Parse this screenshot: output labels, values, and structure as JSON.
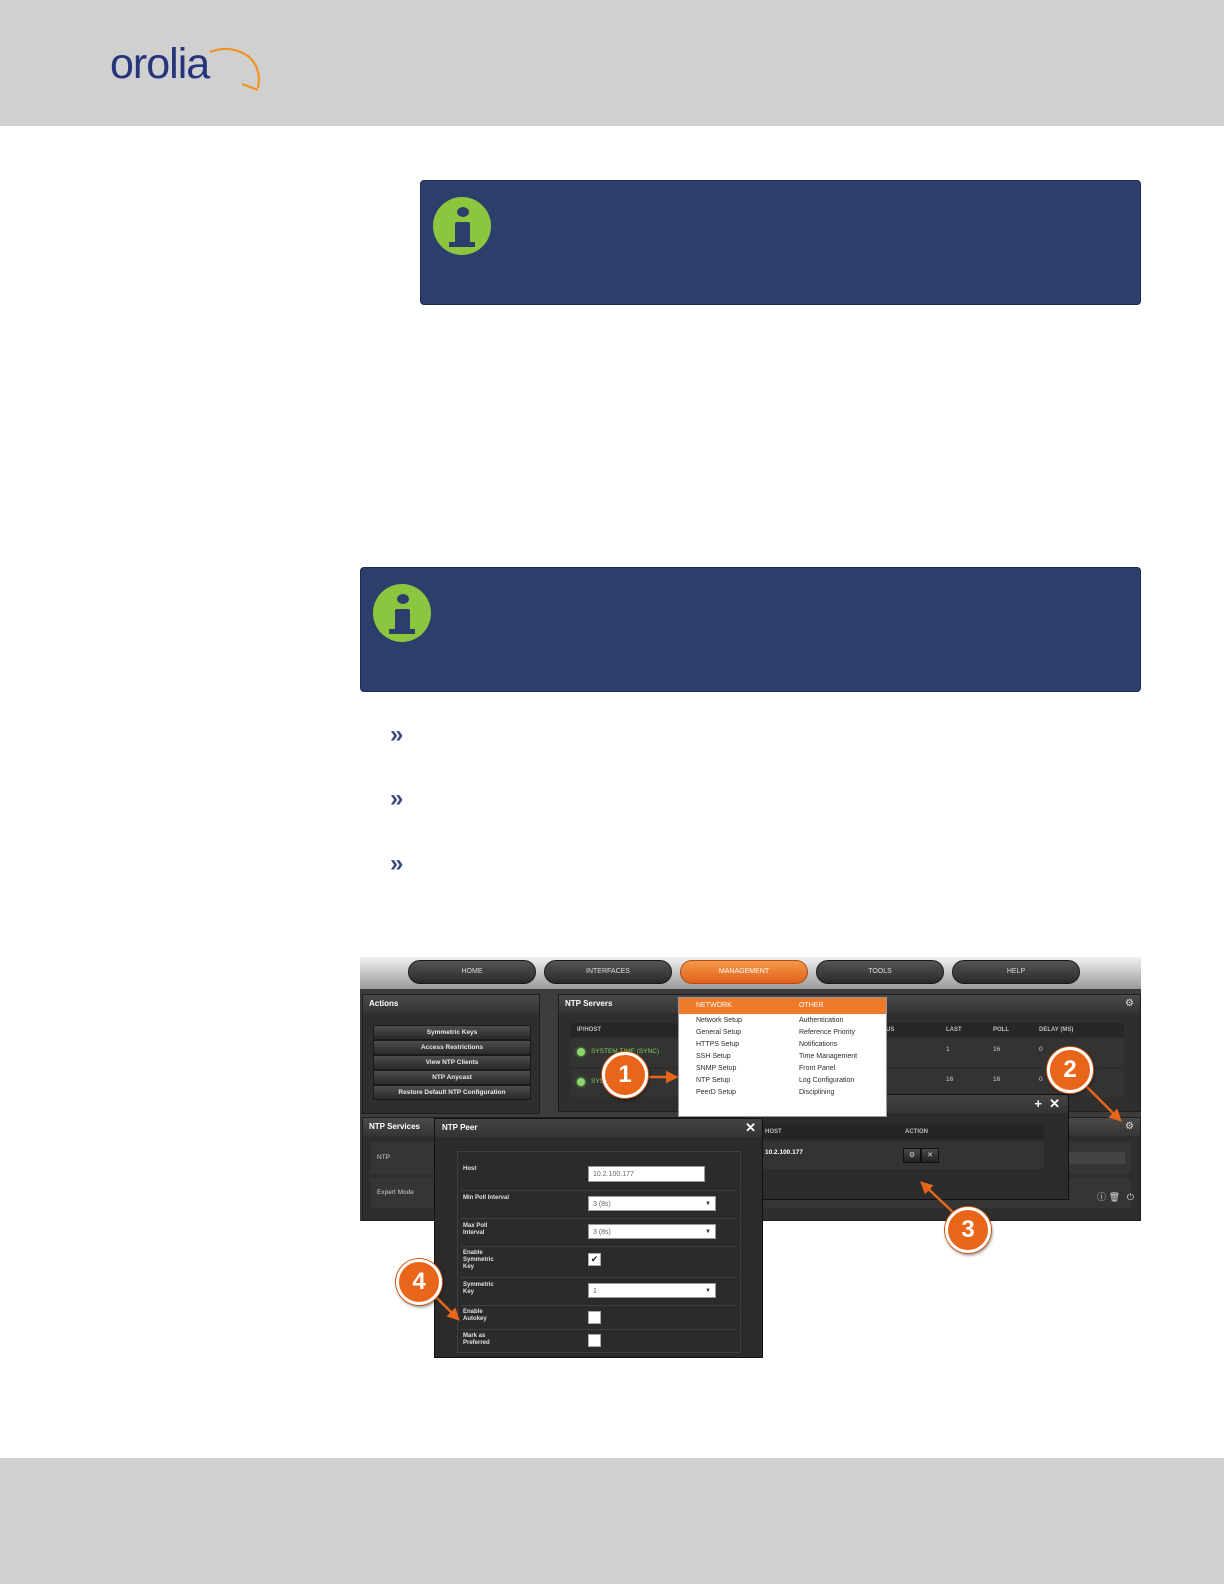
{
  "brand": {
    "logo_text": "orolia"
  },
  "screenshot": {
    "nav": [
      "HOME",
      "INTERFACES",
      "MANAGEMENT",
      "TOOLS",
      "HELP"
    ],
    "actions": {
      "title": "Actions",
      "buttons": [
        "Symmetric Keys",
        "Access Restrictions",
        "View NTP Clients",
        "NTP Anycast",
        "Restore Default NTP Configuration"
      ]
    },
    "ntp_servers": {
      "title": "NTP Servers",
      "columns": [
        "IP/HOST",
        "US",
        "LAST",
        "POLL",
        "DELAY (MS)"
      ],
      "rows": [
        {
          "host": "SYSTEM TIME (SYNC)",
          "last": "1",
          "poll": "16",
          "delay": "0"
        },
        {
          "host": "SYS",
          "last": "16",
          "poll": "16",
          "delay": "0"
        }
      ]
    },
    "menu": {
      "network_head": "NETWORK",
      "other_head": "OTHER",
      "network": [
        "Network Setup",
        "General Setup",
        "HTTPS Setup",
        "SSH Setup",
        "SNMP Setup",
        "NTP Setup",
        "PeerD Setup"
      ],
      "other": [
        "Authentication",
        "Reference Priority",
        "Notifications",
        "Time Management",
        "Front Panel",
        "Log Configuration",
        "Disciplining"
      ]
    },
    "ntp_services": {
      "title": "NTP Services",
      "rows": [
        "NTP",
        "Expert Mode"
      ]
    },
    "ntp_peers": {
      "title": "NTP Peers",
      "columns": [
        "HOST",
        "ACTION"
      ],
      "host": "10.2.100.177"
    },
    "ntp_peer": {
      "title": "NTP Peer",
      "fields": {
        "host_label": "Host",
        "host_value": "10.2.100.177",
        "min_poll_label": "Min Poll Interval",
        "min_poll_value": "3 (8s)",
        "max_poll_label": "Max Poll Interval",
        "max_poll_value": "3 (8s)",
        "enable_symmetric_key_label": "Enable Symmetric Key",
        "symmetric_key_label": "Symmetric Key",
        "symmetric_key_value": "1",
        "enable_autokey_label": "Enable Autokey",
        "mark_preferred_label": "Mark as Preferred"
      },
      "enable_symmetric_key_checked": true,
      "enable_autokey_checked": false,
      "mark_preferred_checked": false
    },
    "callouts": [
      "1",
      "2",
      "3",
      "4"
    ]
  },
  "icons": {
    "info": "info-icon",
    "bullet": "double-chevron-icon",
    "gear": "gear-icon",
    "close": "close-icon",
    "add": "plus-icon"
  },
  "colors": {
    "header": "#d0d0d0",
    "infobox": "#2c3f6c",
    "info_green": "#8cc63f",
    "accent": "#ef7a2a",
    "brand": "#24357a"
  }
}
